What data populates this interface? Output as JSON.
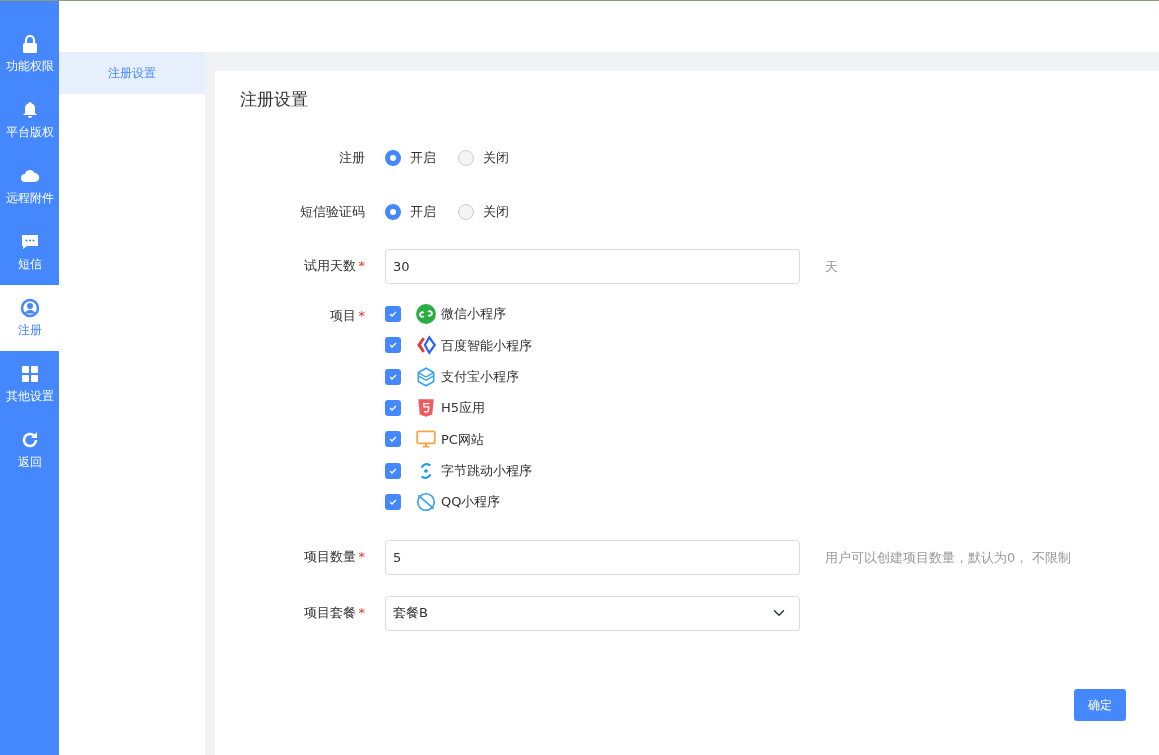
{
  "sidebar": {
    "items": [
      {
        "label": "功能权限",
        "kind": "lock",
        "selected": false
      },
      {
        "label": "平台版权",
        "kind": "bell",
        "selected": false
      },
      {
        "label": "远程附件",
        "kind": "cloud",
        "selected": false
      },
      {
        "label": "短信",
        "kind": "chat",
        "selected": false
      },
      {
        "label": "注册",
        "kind": "user",
        "selected": true
      },
      {
        "label": "其他设置",
        "kind": "grid",
        "selected": false
      },
      {
        "label": "返回",
        "kind": "refresh",
        "selected": false
      }
    ]
  },
  "submenu": {
    "items": [
      {
        "label": "注册设置",
        "selected": true
      }
    ]
  },
  "panel": {
    "title": "注册设置",
    "fields": [
      {
        "kind": "radio",
        "label": "注册",
        "options": [
          {
            "label": "开启",
            "selected": true
          },
          {
            "label": "关闭",
            "selected": false
          }
        ]
      },
      {
        "kind": "radio",
        "label": "短信验证码",
        "options": [
          {
            "label": "开启",
            "selected": true
          },
          {
            "label": "关闭",
            "selected": false
          }
        ]
      },
      {
        "kind": "input",
        "label": "试用天数",
        "required_mark": "*",
        "value": "30",
        "hint": "天"
      },
      {
        "kind": "checklist",
        "label": "项目",
        "required_mark": "*",
        "items": [
          {
            "label": "微信小程序",
            "kind": "wechat",
            "checked": true
          },
          {
            "label": "百度智能小程序",
            "kind": "baidu",
            "checked": true
          },
          {
            "label": "支付宝小程序",
            "kind": "alipay",
            "checked": true
          },
          {
            "label": "H5应用",
            "kind": "h5",
            "checked": true
          },
          {
            "label": "PC网站",
            "kind": "pc",
            "checked": true
          },
          {
            "label": "字节跳动小程序",
            "kind": "bytedance",
            "checked": true
          },
          {
            "label": "QQ小程序",
            "kind": "qq",
            "checked": true
          }
        ]
      },
      {
        "kind": "input",
        "label": "项目数量",
        "required_mark": "*",
        "value": "5",
        "hint": "用户可以创建项目数量，默认为0， 不限制"
      },
      {
        "kind": "select",
        "label": "项目套餐",
        "required_mark": "*",
        "value": "套餐B"
      }
    ],
    "submit": "确定"
  }
}
